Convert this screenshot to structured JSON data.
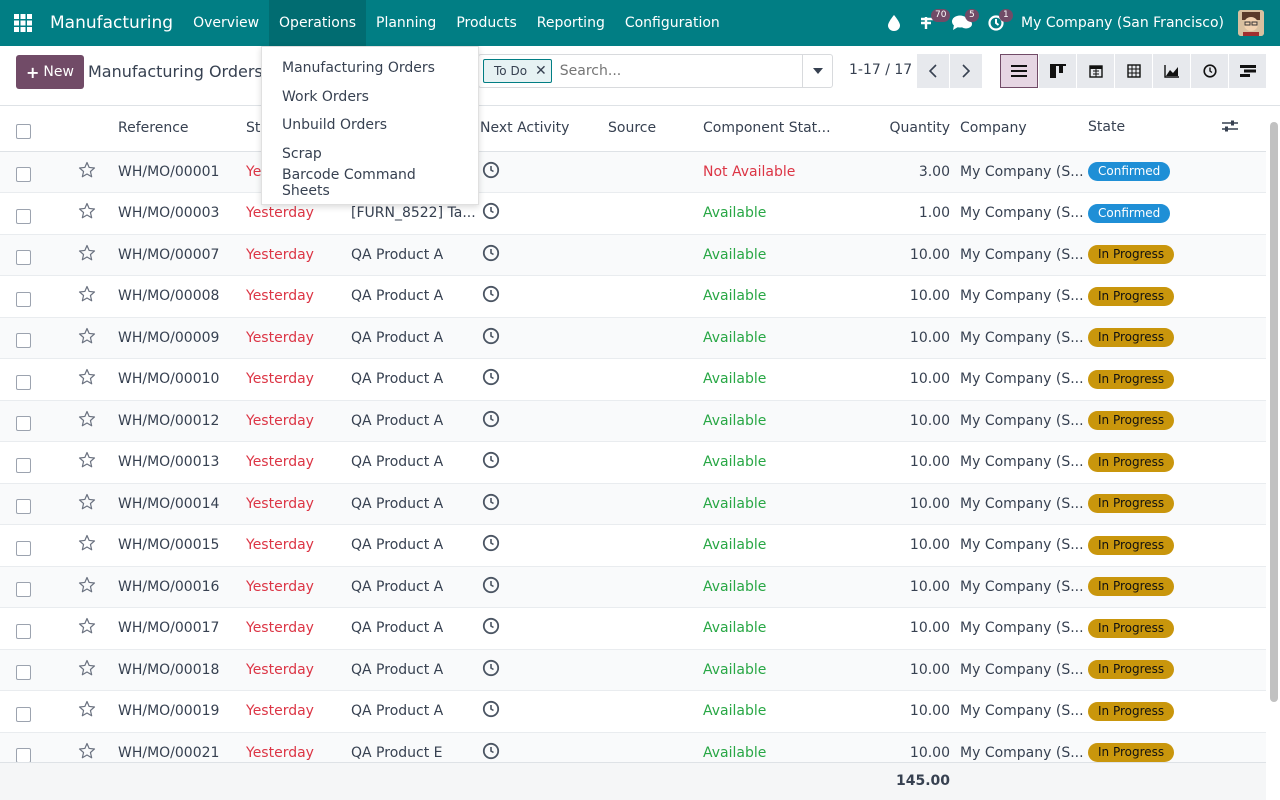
{
  "navbar": {
    "app_title": "Manufacturing",
    "menu": [
      "Overview",
      "Operations",
      "Planning",
      "Products",
      "Reporting",
      "Configuration"
    ],
    "badges": {
      "activities": "70",
      "messages": "5",
      "clock": "1"
    },
    "company": "My Company (San Francisco)"
  },
  "control": {
    "new_label": "New",
    "breadcrumb": "Manufacturing Orders",
    "facet": "To Do",
    "search_placeholder": "Search...",
    "pager": "1-17 / 17"
  },
  "dropdown": [
    "Manufacturing Orders",
    "Work Orders",
    "Unbuild Orders",
    "Scrap",
    "Barcode Command Sheets"
  ],
  "table": {
    "headers": [
      "Reference",
      "St",
      "",
      "Next Activity",
      "Source",
      "Component Stat...",
      "Quantity",
      "Company",
      "State"
    ],
    "rows": [
      {
        "ref": "WH/MO/00001",
        "start": "Ye",
        "product": "",
        "component": "Not Available",
        "qty": "3.00",
        "company": "My Company (S...",
        "state": "Confirmed"
      },
      {
        "ref": "WH/MO/00003",
        "start": "Yesterday",
        "product": "[FURN_8522] Ta...",
        "component": "Available",
        "qty": "1.00",
        "company": "My Company (S...",
        "state": "Confirmed"
      },
      {
        "ref": "WH/MO/00007",
        "start": "Yesterday",
        "product": "QA Product A",
        "component": "Available",
        "qty": "10.00",
        "company": "My Company (S...",
        "state": "In Progress"
      },
      {
        "ref": "WH/MO/00008",
        "start": "Yesterday",
        "product": "QA Product A",
        "component": "Available",
        "qty": "10.00",
        "company": "My Company (S...",
        "state": "In Progress"
      },
      {
        "ref": "WH/MO/00009",
        "start": "Yesterday",
        "product": "QA Product A",
        "component": "Available",
        "qty": "10.00",
        "company": "My Company (S...",
        "state": "In Progress"
      },
      {
        "ref": "WH/MO/00010",
        "start": "Yesterday",
        "product": "QA Product A",
        "component": "Available",
        "qty": "10.00",
        "company": "My Company (S...",
        "state": "In Progress"
      },
      {
        "ref": "WH/MO/00012",
        "start": "Yesterday",
        "product": "QA Product A",
        "component": "Available",
        "qty": "10.00",
        "company": "My Company (S...",
        "state": "In Progress"
      },
      {
        "ref": "WH/MO/00013",
        "start": "Yesterday",
        "product": "QA Product A",
        "component": "Available",
        "qty": "10.00",
        "company": "My Company (S...",
        "state": "In Progress"
      },
      {
        "ref": "WH/MO/00014",
        "start": "Yesterday",
        "product": "QA Product A",
        "component": "Available",
        "qty": "10.00",
        "company": "My Company (S...",
        "state": "In Progress"
      },
      {
        "ref": "WH/MO/00015",
        "start": "Yesterday",
        "product": "QA Product A",
        "component": "Available",
        "qty": "10.00",
        "company": "My Company (S...",
        "state": "In Progress"
      },
      {
        "ref": "WH/MO/00016",
        "start": "Yesterday",
        "product": "QA Product A",
        "component": "Available",
        "qty": "10.00",
        "company": "My Company (S...",
        "state": "In Progress"
      },
      {
        "ref": "WH/MO/00017",
        "start": "Yesterday",
        "product": "QA Product A",
        "component": "Available",
        "qty": "10.00",
        "company": "My Company (S...",
        "state": "In Progress"
      },
      {
        "ref": "WH/MO/00018",
        "start": "Yesterday",
        "product": "QA Product A",
        "component": "Available",
        "qty": "10.00",
        "company": "My Company (S...",
        "state": "In Progress"
      },
      {
        "ref": "WH/MO/00019",
        "start": "Yesterday",
        "product": "QA Product A",
        "component": "Available",
        "qty": "10.00",
        "company": "My Company (S...",
        "state": "In Progress"
      },
      {
        "ref": "WH/MO/00021",
        "start": "Yesterday",
        "product": "QA Product E",
        "component": "Available",
        "qty": "10.00",
        "company": "My Company (S...",
        "state": "In Progress"
      }
    ],
    "total_quantity": "145.00"
  },
  "colors": {
    "brand": "#017e84",
    "primary": "#714b67",
    "danger": "#dc3545",
    "success": "#28a745",
    "confirmed": "#1f8fd6",
    "in_progress": "#c9960c"
  }
}
